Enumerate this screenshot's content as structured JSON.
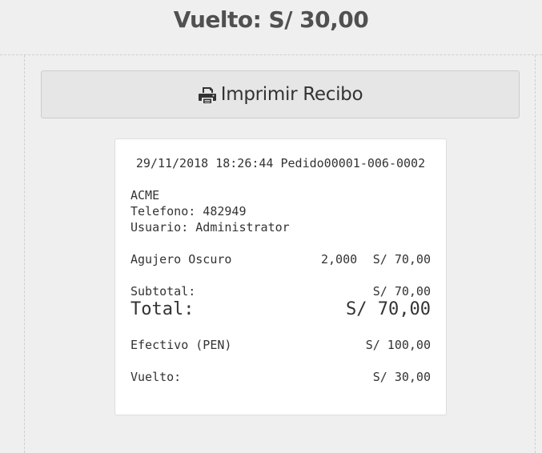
{
  "header": {
    "change_title": "Vuelto: S/ 30,00"
  },
  "toolbar": {
    "print_label": "Imprimir Recibo",
    "print_icon": "printer-icon"
  },
  "receipt": {
    "date": "29/11/2018",
    "time": "18:26:44",
    "order": "Pedido00001-006-0002",
    "company": "ACME",
    "phone": "Telefono: 482949",
    "user": "Usuario: Administrator",
    "items": [
      {
        "name": "Agujero Oscuro",
        "qty": "2,000",
        "price": "S/ 70,00"
      }
    ],
    "subtotal_label": "Subtotal:",
    "subtotal_value": "S/ 70,00",
    "total_label": "Total:",
    "total_value": "S/ 70,00",
    "payment_label": "Efectivo (PEN)",
    "payment_value": "S/ 100,00",
    "change_label": "Vuelto:",
    "change_value": "S/ 30,00"
  }
}
